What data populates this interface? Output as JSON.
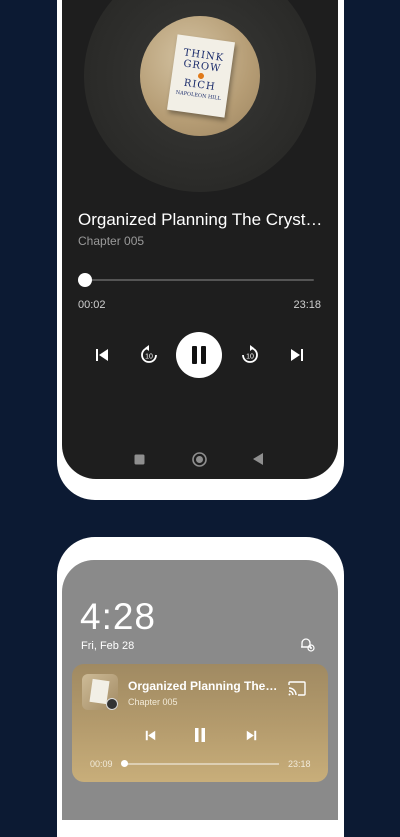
{
  "player": {
    "track_title": "Organized Planning The Crystallization of Desire",
    "track_subtitle": "Chapter 005",
    "time_elapsed": "00:02",
    "time_total": "23:18",
    "progress": 0.01,
    "skip_back_seconds": "10",
    "skip_forward_seconds": "10",
    "cover_book_lines": [
      "THINK",
      "GROW",
      "RICH",
      "NAPOLEON HILL"
    ]
  },
  "lockscreen": {
    "time": "4:28",
    "date": "Fri, Feb 28",
    "media": {
      "title": "Organized Planning The Crystallization of Desire",
      "subtitle": "Chapter 005",
      "time_elapsed": "00:09",
      "time_total": "23:18",
      "progress": 0.02
    }
  },
  "colors": {
    "background": "#0c1a33",
    "player_screen": "#1e1e1e",
    "lockscreen_bg": "#8a8a8a",
    "media_card": "#b39a6c"
  },
  "icons": {
    "prev": "skip-previous-icon",
    "rewind": "replay-10-icon",
    "pause": "pause-icon",
    "forward": "forward-10-icon",
    "next": "skip-next-icon",
    "nav_recents": "square-icon",
    "nav_home": "circle-icon",
    "nav_back": "triangle-back-icon",
    "bell": "notification-settings-icon",
    "cast": "cast-icon"
  }
}
